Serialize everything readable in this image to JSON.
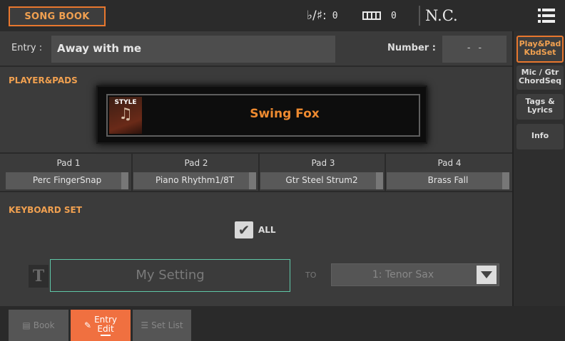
{
  "topbar": {
    "mode": "SONG BOOK",
    "accidental_symbol": "♭/♯:",
    "accidental_value": "0",
    "keyboard_value": "0",
    "chord": "N.C."
  },
  "entry": {
    "label": "Entry :",
    "value": "Away with me",
    "number_label": "Number :",
    "number_value": "- -"
  },
  "player_pads": {
    "title": "PLAYER&PADS",
    "style_tag": "STYLE",
    "style_name": "Swing Fox",
    "pads": [
      {
        "label": "Pad 1",
        "value": "Perc FingerSnap"
      },
      {
        "label": "Pad 2",
        "value": "Piano Rhythm1/8T"
      },
      {
        "label": "Pad 3",
        "value": "Gtr Steel Strum2"
      },
      {
        "label": "Pad 4",
        "value": "Brass Fall"
      }
    ]
  },
  "keyboard_set": {
    "title": "KEYBOARD SET",
    "all_label": "ALL",
    "all_checked": true,
    "name_value": "My Setting",
    "to_label": "TO",
    "destination": "1: Tenor Sax"
  },
  "side_tabs": [
    {
      "line1": "Play&Pad",
      "line2": "KbdSet",
      "active": true
    },
    {
      "line1": "Mic / Gtr",
      "line2": "ChordSeq",
      "active": false
    },
    {
      "line1": "Tags &",
      "line2": "Lyrics",
      "active": false
    },
    {
      "line1": "Info",
      "line2": "",
      "active": false
    }
  ],
  "bottom_tabs": {
    "book": "Book",
    "entry_line1": "Entry",
    "entry_line2": "Edit",
    "setlist": "Set List"
  },
  "colors": {
    "accent": "#e8772e",
    "style_text": "#ee8a30",
    "active_bottom_tab": "#f07040",
    "field_highlight": "#5fc8a8"
  }
}
